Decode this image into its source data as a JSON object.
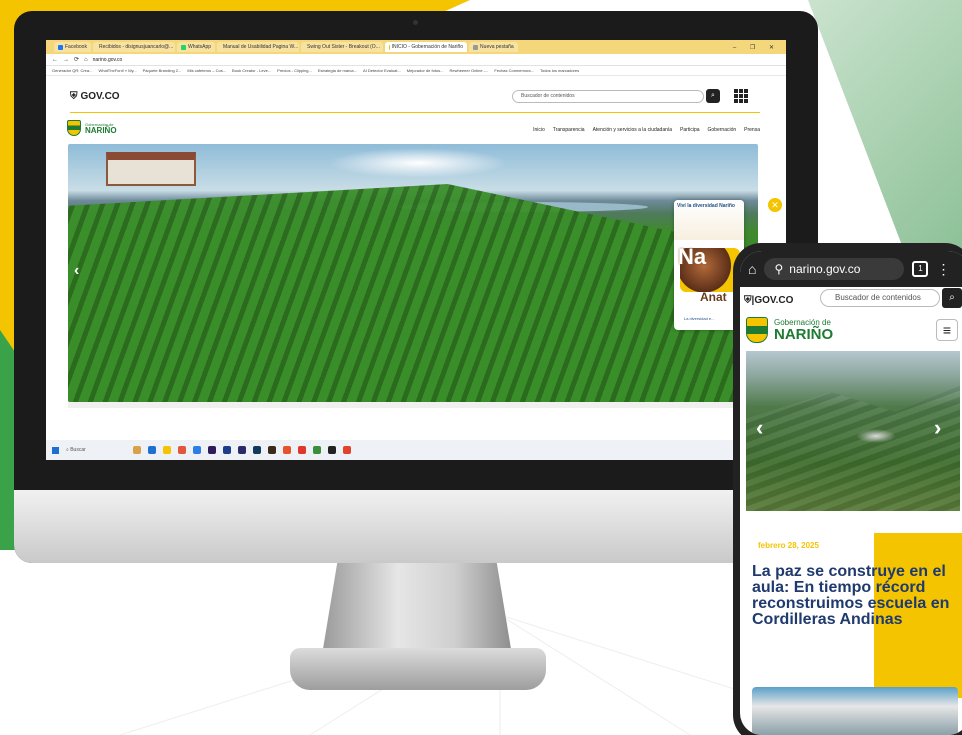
{
  "desktop": {
    "browser": {
      "tabs": [
        {
          "label": "Facebook",
          "color": "#1877f2"
        },
        {
          "label": "Recibidos - disignusjuancarlo@...",
          "color": "#d93025"
        },
        {
          "label": "WhatsApp",
          "color": "#25d366"
        },
        {
          "label": "Manual de Usabilidad Pagina W...",
          "color": "#0f9d58"
        },
        {
          "label": "Swing Out Sister - Breakout (O...",
          "color": "#ff0000"
        },
        {
          "label": "INICIO - Gobernación de Nariño",
          "color": "#f5c400",
          "active": true
        },
        {
          "label": "Nueva pestaña",
          "color": "#999999"
        }
      ],
      "window_controls": "– ❐ ✕",
      "url": "narino.gov.co",
      "bookmarks": [
        "Generador QR: Crea...",
        "WhatTheFont! » My...",
        "Paquete Branding 2...",
        "Mis cafeteros – Cos...",
        "Book Creator - Leve...",
        "Precios - Clipping...",
        "Estrategia de marca...",
        "AI Detector Evaluat...",
        "Mejorador de fotos...",
        "Rewheeeer Online -...",
        "Fechas Conmemora...",
        "Todos los marcadores"
      ]
    },
    "page": {
      "gov_logo": "GOV.CO",
      "search_placeholder": "Buscador de contenidos",
      "brand_small": "Gobernación de",
      "brand_big": "NARIÑO",
      "nav": [
        "Inicio",
        "Transparencia",
        "Atención y servicios a la ciudadanía",
        "Participa",
        "Gobernación",
        "Prensa"
      ],
      "popup": {
        "top_text": "Viví la diversidad Nariño",
        "big_letters": "Na",
        "ana": "Anat",
        "foot": "La diversidad e..."
      }
    },
    "taskbar": {
      "search": "Buscar",
      "clock": "^ ⊕ 🔊 ⊡"
    }
  },
  "phone": {
    "url": "narino.gov.co",
    "tab_count": "1",
    "gov_logo": "GOV.CO",
    "search_placeholder": "Buscador de contenidos",
    "brand_small": "Gobernación de",
    "brand_big": "NARIÑO",
    "date": "febrero 28, 2025",
    "headline": "La paz se construye en el aula: En tiempo récord reconstruimos escuela en Cordilleras Andinas"
  },
  "colors": {
    "brand_yellow": "#f5c400",
    "brand_green": "#1f7a33",
    "headline_blue": "#1f3a6e"
  }
}
